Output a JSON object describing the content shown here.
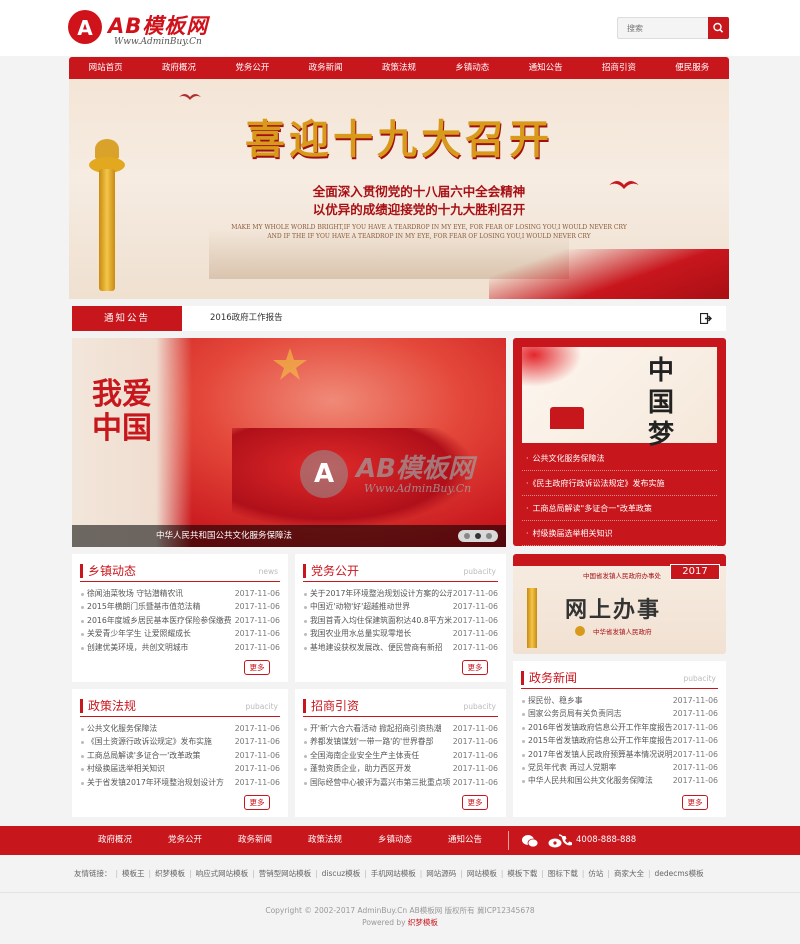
{
  "brand": {
    "logo_letter": "A",
    "name": "AB模板网",
    "url": "Www.AdminBuy.Cn"
  },
  "search": {
    "placeholder": "搜索"
  },
  "nav": [
    "网站首页",
    "政府概况",
    "党务公开",
    "政务新闻",
    "政策法规",
    "乡镇动态",
    "通知公告",
    "招商引资",
    "便民服务"
  ],
  "banner": {
    "title": "喜迎十九大召开",
    "sub1": "全面深入贯彻党的十八届六中全会精神",
    "sub2": "以优异的成绩迎接党的十九大胜利召开",
    "en1": "MAKE MY WHOLE WORLD BRIGHT,IF YOU HAVE A TEARDROP IN MY EYE, FOR FEAR OF LOSING YOU,I WOULD NEVER CRY",
    "en2": "AND IF THE IF YOU HAVE A TEARDROP IN MY EYE, FOR FEAR OF LOSING YOU,I WOULD NEVER CRY"
  },
  "notice": {
    "label": "通知公告",
    "text": "2016政府工作报告"
  },
  "slider": {
    "calligraphy": "我爱中国",
    "caption": "中华人民共和国公共文化服务保障法"
  },
  "watermark": {
    "letter": "A",
    "name": "AB模板网",
    "url": "Www.AdminBuy.Cn"
  },
  "right_box": {
    "image_text": "中国梦",
    "items": [
      "公共文化服务保障法",
      "《民主政府行政诉讼法规定》发布实施",
      "工商总局解读\"多证合一\"改革政策",
      "村级换届选举相关知识"
    ]
  },
  "panels": {
    "xiangzhen": {
      "title": "乡镇动态",
      "more_en": "news",
      "more": "更多",
      "items": [
        [
          "徐闻油菜牧场 守钻潜精农讯",
          "2017-11-06"
        ],
        [
          "2015年横朗门乐暨基市值范法精",
          "2017-11-06"
        ],
        [
          "2016年度城乡居民基本医疗保险参保缴费",
          "2017-11-06"
        ],
        [
          "关爱青少年学生 让爱照耀成长",
          "2017-11-06"
        ],
        [
          "创建优美环境，共创文明城市",
          "2017-11-06"
        ]
      ]
    },
    "dangwu": {
      "title": "党务公开",
      "more_en": "pubacity",
      "more": "更多",
      "items": [
        [
          "关于2017年环境整治规划设计方案的公示",
          "2017-11-06"
        ],
        [
          "中国近'动物'好'超越推动世界",
          "2017-11-06"
        ],
        [
          "我国首青入均住保建筑面积达40.8平方米",
          "2017-11-06"
        ],
        [
          "我国农业用水总量实现零增长",
          "2017-11-06"
        ],
        [
          "基地建设获权发展改、便民营商有新招",
          "2017-11-06"
        ]
      ]
    },
    "zhengce": {
      "title": "政策法规",
      "more_en": "pubacity",
      "more": "更多",
      "items": [
        [
          "公共文化服务保障法",
          "2017-11-06"
        ],
        [
          "《国土资源行政诉讼规定》发布实施",
          "2017-11-06"
        ],
        [
          "工商总局解读'多证合一'改革政策",
          "2017-11-06"
        ],
        [
          "村级换届选举相关知识",
          "2017-11-06"
        ],
        [
          "关于省发镇2017年环境整治规划设计方",
          "2017-11-06"
        ]
      ]
    },
    "zhaoshang": {
      "title": "招商引资",
      "more_en": "pubacity",
      "more": "更多",
      "items": [
        [
          "开'新'六合六看活动 掀起招商引资热潮",
          "2017-11-06"
        ],
        [
          "养都发镇谋划'一带一路'的'世界眷部",
          "2017-11-06"
        ],
        [
          "全国海南企业安全生产主体责任",
          "2017-11-06"
        ],
        [
          "蓬勃资质企业，助力西区开发",
          "2017-11-06"
        ],
        [
          "国际经营中心被评为嘉兴市第三批重点项",
          "2017-11-06"
        ]
      ]
    },
    "zhengwu": {
      "title": "政务新闻",
      "more_en": "pubacity",
      "more": "更多",
      "items": [
        [
          "探民份、稳乡事",
          "2017-11-06"
        ],
        [
          "国家公务员局有关负责同志",
          "2017-11-06"
        ],
        [
          "2016年省发镇政府信息公开工作年度报告",
          "2017-11-06"
        ],
        [
          "2015年省发镇政府信息公开工作年度报告",
          "2017-11-06"
        ],
        [
          "2017年省发镇人民政府预算基本情况说明",
          "2017-11-06"
        ],
        [
          "党员年代表 再过人党期率",
          "2017-11-06"
        ],
        [
          "中华人民共和国公共文化服务保障法",
          "2017-11-06"
        ]
      ]
    }
  },
  "office": {
    "year": "2017",
    "big": "网上办事",
    "header": "中国省发镇人民政府办事处",
    "stamp": "中华省发镇人民政府"
  },
  "footer_nav": [
    "政府概况",
    "党务公开",
    "政务新闻",
    "政策法规",
    "乡镇动态",
    "通知公告"
  ],
  "phone": "4008-888-888",
  "friend_links": {
    "label": "友情链接：",
    "items": [
      "模板王",
      "织梦模板",
      "响应式网站模板",
      "营销型网站模板",
      "discuz模板",
      "手机网站模板",
      "网站源码",
      "网站模板",
      "模板下载",
      "图标下载",
      "仿站",
      "商家大全",
      "dedecms模板"
    ]
  },
  "copyright": {
    "line1": "Copyright © 2002-2017 AdminBuy.Cn AB模板网 版权所有 冀ICP12345678",
    "powered": "Powered by ",
    "powered_link": "织梦模板"
  },
  "colors": {
    "primary": "#c8161d"
  }
}
